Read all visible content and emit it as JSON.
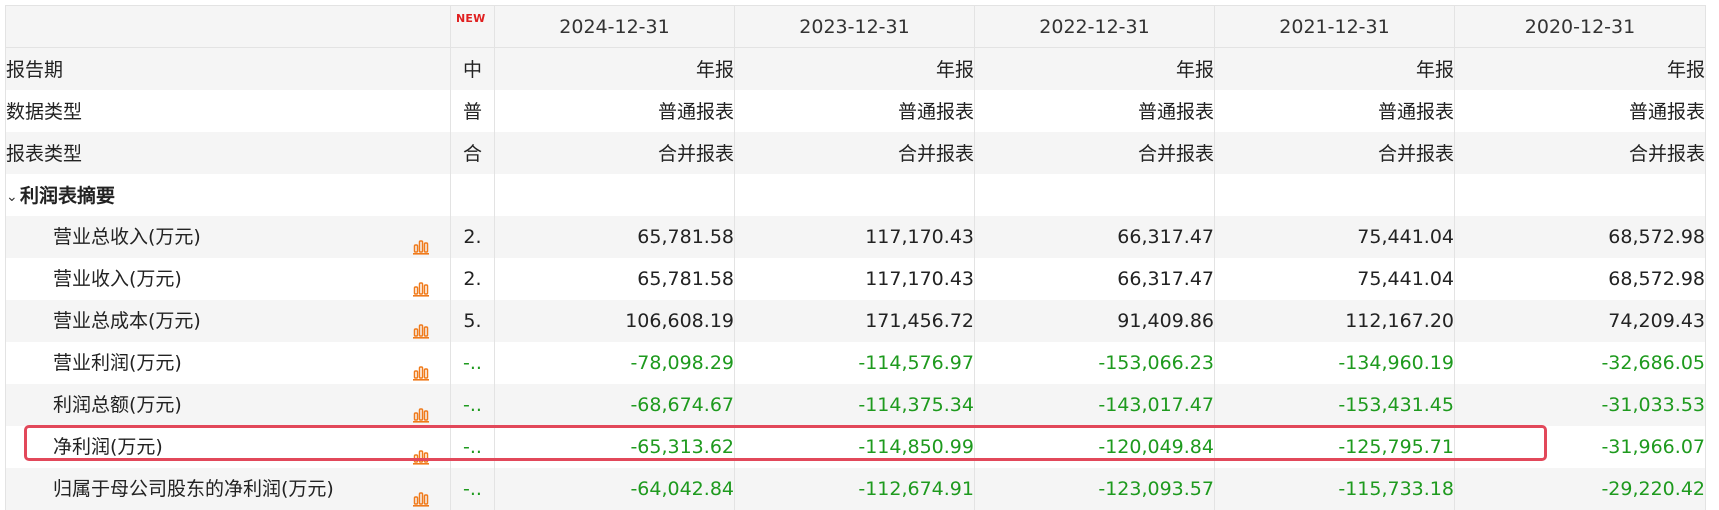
{
  "header": {
    "new_badge": "NEW",
    "periods": [
      "2024-12-31",
      "2023-12-31",
      "2022-12-31",
      "2021-12-31",
      "2020-12-31"
    ]
  },
  "meta_rows": [
    {
      "label": "报告期",
      "mini": "中",
      "values": [
        "年报",
        "年报",
        "年报",
        "年报",
        "年报"
      ]
    },
    {
      "label": "数据类型",
      "mini": "普",
      "values": [
        "普通报表",
        "普通报表",
        "普通报表",
        "普通报表",
        "普通报表"
      ]
    },
    {
      "label": "报表类型",
      "mini": "合",
      "values": [
        "合并报表",
        "合并报表",
        "合并报表",
        "合并报表",
        "合并报表"
      ]
    }
  ],
  "section": {
    "chevron": "⌄",
    "title": "利润表摘要"
  },
  "rows": [
    {
      "label": "营业总收入(万元)",
      "mini": "2.",
      "values": [
        "65,781.58",
        "117,170.43",
        "66,317.47",
        "75,441.04",
        "68,572.98"
      ],
      "negative": false
    },
    {
      "label": "营业收入(万元)",
      "mini": "2.",
      "values": [
        "65,781.58",
        "117,170.43",
        "66,317.47",
        "75,441.04",
        "68,572.98"
      ],
      "negative": false
    },
    {
      "label": "营业总成本(万元)",
      "mini": "5.",
      "values": [
        "106,608.19",
        "171,456.72",
        "91,409.86",
        "112,167.20",
        "74,209.43"
      ],
      "negative": false
    },
    {
      "label": "营业利润(万元)",
      "mini": "-..",
      "values": [
        "-78,098.29",
        "-114,576.97",
        "-153,066.23",
        "-134,960.19",
        "-32,686.05"
      ],
      "negative": true
    },
    {
      "label": "利润总额(万元)",
      "mini": "-..",
      "values": [
        "-68,674.67",
        "-114,375.34",
        "-143,017.47",
        "-153,431.45",
        "-31,033.53"
      ],
      "negative": true
    },
    {
      "label": "净利润(万元)",
      "mini": "-..",
      "values": [
        "-65,313.62",
        "-114,850.99",
        "-120,049.84",
        "-125,795.71",
        "-31,966.07"
      ],
      "negative": true
    },
    {
      "label": "归属于母公司股东的净利润(万元)",
      "mini": "-..",
      "values": [
        "-64,042.84",
        "-112,674.91",
        "-123,093.57",
        "-115,733.18",
        "-29,220.42"
      ],
      "negative": true
    }
  ],
  "colors": {
    "negative": "#1e9a1e",
    "icon_orange": "#f07a1a",
    "highlight_border": "#e2485a",
    "new_badge": "#e02020"
  },
  "icons": {
    "row_chart": "bar-chart-icon",
    "section_toggle": "chevron-down-icon"
  }
}
